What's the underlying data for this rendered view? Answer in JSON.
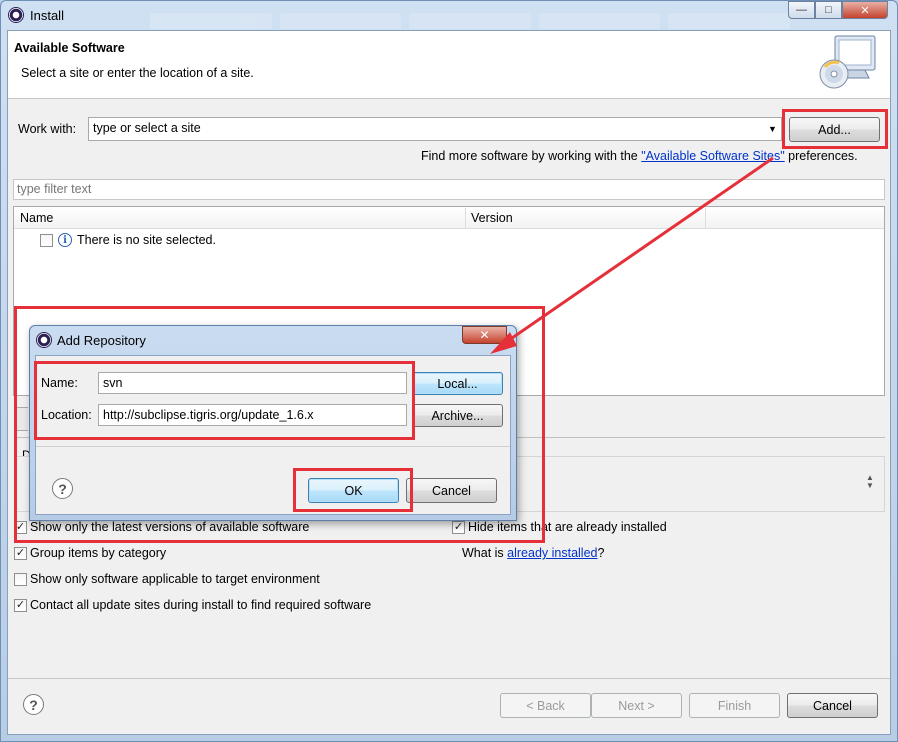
{
  "window": {
    "title": "Install",
    "controls": {
      "minimize": "—",
      "maximize": "□",
      "close": "✕"
    }
  },
  "banner": {
    "title": "Available Software",
    "description": "Select a site or enter the location of a site.",
    "icon": "cd-monitor-icon"
  },
  "work_with": {
    "label": "Work with:",
    "placeholder": "type or select a site",
    "add_button": "Add...",
    "find_more_prefix": "Find more software by working with the ",
    "find_more_link": "\"Available Software Sites\"",
    "find_more_suffix": " preferences."
  },
  "filter": {
    "placeholder": "type filter text"
  },
  "tree": {
    "columns": [
      "Name",
      "Version"
    ],
    "rows": [
      {
        "label": "There is no site selected.",
        "checked": false,
        "icon": "info-icon"
      }
    ]
  },
  "options": {
    "show_latest": {
      "label": "Show only the latest versions of available software",
      "checked": true
    },
    "hide_installed": {
      "label": "Hide items that are already installed",
      "checked": true
    },
    "group_by_category": {
      "label": "Group items by category",
      "checked": true
    },
    "what_is_prefix": "What is ",
    "what_is_link": "already installed",
    "what_is_suffix": "?",
    "applicable_only": {
      "label": "Show only software applicable to target environment",
      "checked": false
    },
    "contact_all": {
      "label": "Contact all update sites during install to find required software",
      "checked": true
    }
  },
  "footer": {
    "back": "< Back",
    "next": "Next >",
    "finish": "Finish",
    "cancel": "Cancel"
  },
  "dialog": {
    "title": "Add Repository",
    "name_label": "Name:",
    "name_value": "svn",
    "location_label": "Location:",
    "location_value": "http://subclipse.tigris.org/update_1.6.x",
    "local_button": "Local...",
    "archive_button": "Archive...",
    "ok_button": "OK",
    "cancel_button": "Cancel"
  },
  "colors": {
    "annotation_red": "#e5303a",
    "link_blue": "#0033cc"
  }
}
